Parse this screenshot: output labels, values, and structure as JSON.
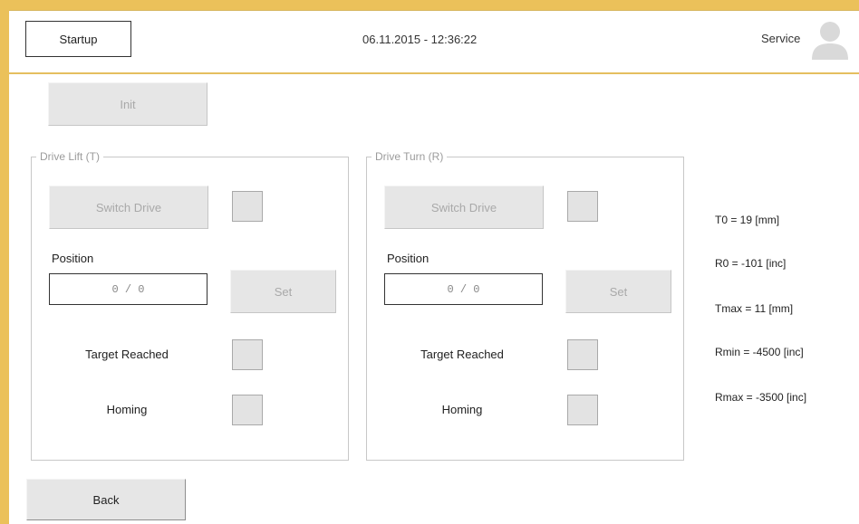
{
  "header": {
    "startup_label": "Startup",
    "datetime": "06.11.2015  -  12:36:22",
    "user_label": "Service",
    "avatar_icon": "user-avatar-icon"
  },
  "init_label": "Init",
  "drives": [
    {
      "title": "Drive Lift (T)",
      "switch_label": "Switch Drive",
      "position_label": "Position",
      "position_value": "0  / 0",
      "set_label": "Set",
      "target_reached_label": "Target Reached",
      "homing_label": "Homing"
    },
    {
      "title": "Drive Turn (R)",
      "switch_label": "Switch Drive",
      "position_label": "Position",
      "position_value": "0  / 0",
      "set_label": "Set",
      "target_reached_label": "Target Reached",
      "homing_label": "Homing"
    }
  ],
  "params": [
    "T0 = 19 [mm]",
    "R0 = -101 [inc]",
    "Tmax = 11 [mm]",
    "Rmin = -4500 [inc]",
    "Rmax = -3500 [inc]"
  ],
  "back_label": "Back",
  "colors": {
    "frame_border": "#ebc15a",
    "button_face": "#e6e6e6",
    "indicator": "#e3e3e3"
  }
}
